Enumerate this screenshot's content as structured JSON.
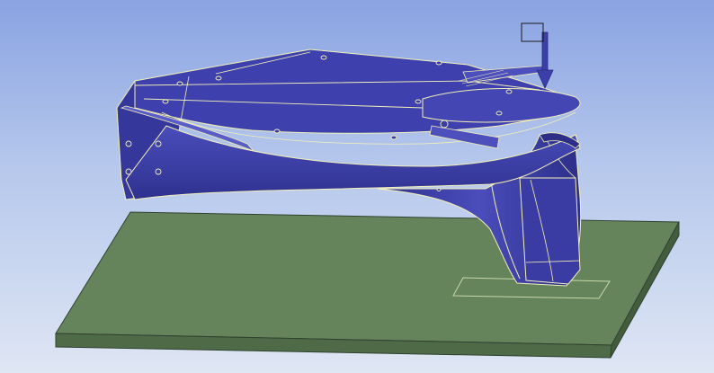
{
  "viewport": {
    "background_top": "#8aa3e2",
    "background_bottom": "#dfe6f4"
  },
  "model": {
    "body_color": "#3c3fa8",
    "body_highlight": "#5558c4",
    "body_shadow": "#2b2d86",
    "edge_color": "#f3f0b8",
    "base_plate_top": "#66845c",
    "base_plate_front": "#4e6a47",
    "base_plate_side": "#435c3d",
    "base_edge": "#2f4230"
  },
  "load_marker": {
    "icon": "force-arrow-icon",
    "color": "#3c3fa8"
  },
  "triad": {
    "icon": "coordinate-box-icon"
  }
}
